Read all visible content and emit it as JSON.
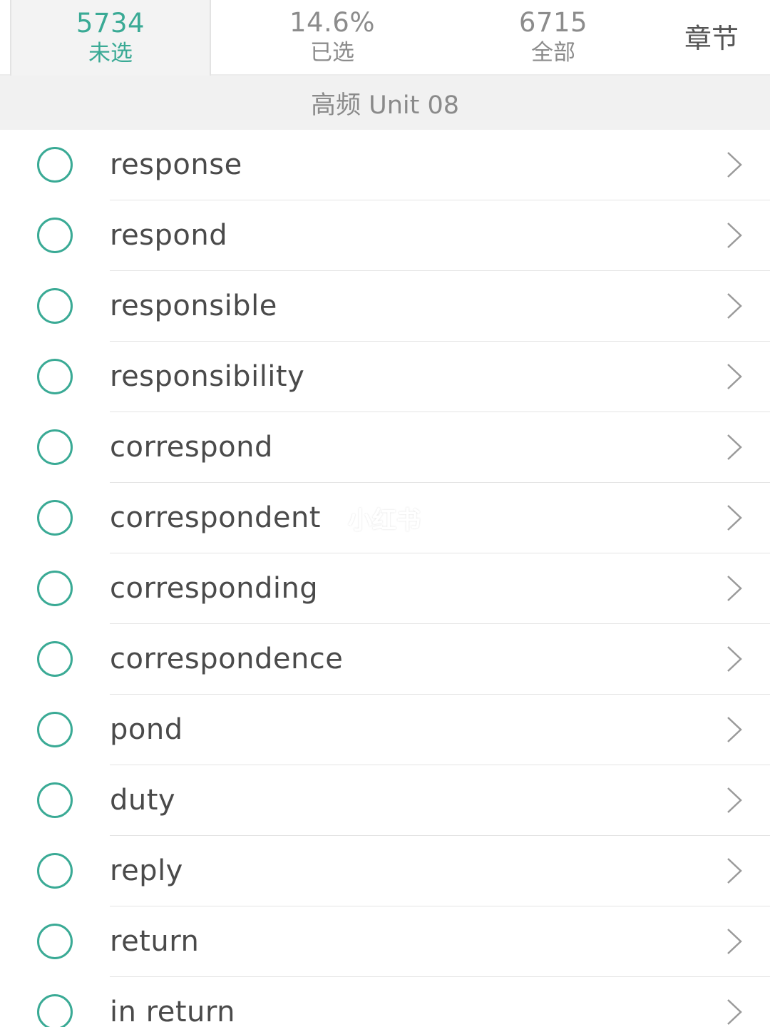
{
  "tabs": {
    "unselected": {
      "count": "5734",
      "label": "未选"
    },
    "selected": {
      "count": "14.6%",
      "label": "已选"
    },
    "all": {
      "count": "6715",
      "label": "全部"
    }
  },
  "chapter_label": "章节",
  "section_title": "高频 Unit 08",
  "words": [
    "response",
    "respond",
    "responsible",
    "responsibility",
    "correspond",
    "correspondent",
    "corresponding",
    "correspondence",
    "pond",
    "duty",
    "reply",
    "return",
    "in return"
  ],
  "icons": {
    "checkbox": "circle-checkbox-icon",
    "row_arrow": "chevron-right-icon"
  },
  "watermark": "小红书",
  "colors": {
    "accent": "#3aaa95",
    "text": "#4a4a4a",
    "muted": "#8c8c8c",
    "header_bg": "#f1f1f1"
  }
}
